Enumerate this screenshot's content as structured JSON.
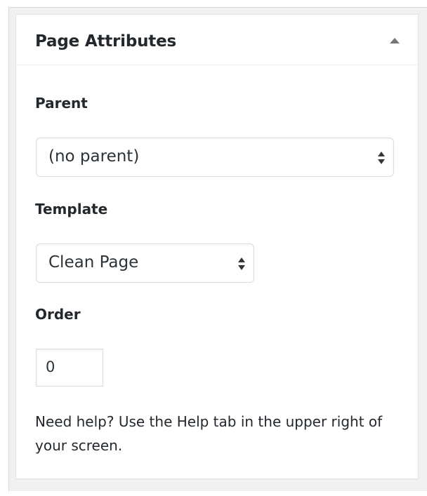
{
  "metabox": {
    "title": "Page Attributes"
  },
  "parent": {
    "label": "Parent",
    "selected": "(no parent)"
  },
  "template": {
    "label": "Template",
    "selected": "Clean Page"
  },
  "order": {
    "label": "Order",
    "value": "0"
  },
  "help": {
    "text": "Need help? Use the Help tab in the upper right of your screen."
  },
  "icons": {
    "toggle": "collapse-arrow-up-icon",
    "select": "select-updown-icon"
  }
}
